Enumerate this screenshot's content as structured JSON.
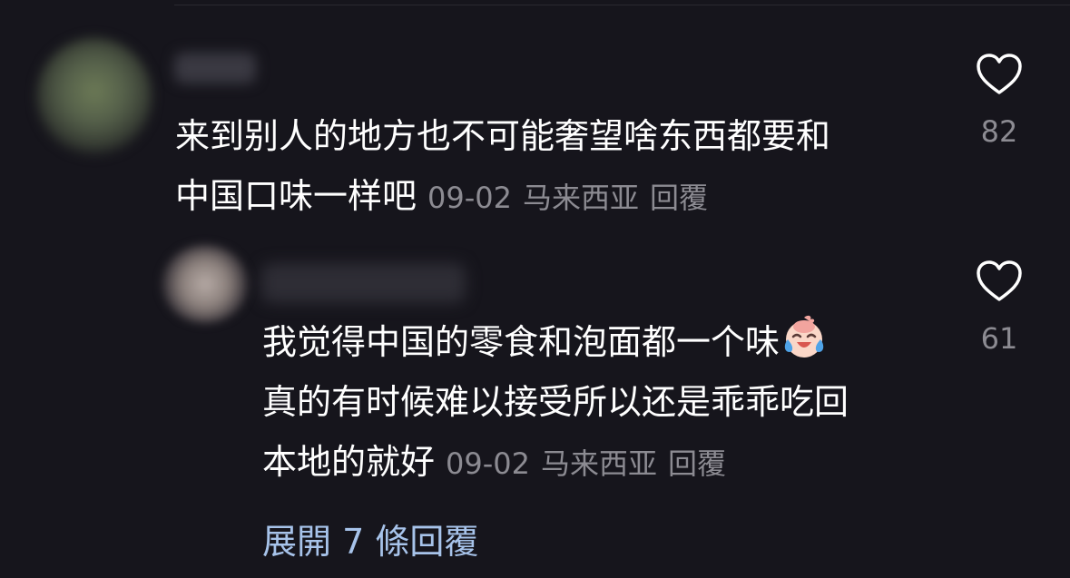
{
  "comments": [
    {
      "lines": [
        "来到别人的地方也不可能奢望啥东西都要和",
        "中国口味一样吧"
      ],
      "date": "09-02",
      "location": "马来西亚",
      "reply_label": "回覆",
      "likes": "82"
    },
    {
      "lines": [
        "我觉得中国的零食和泡面都一个味",
        "真的有时候难以接受所以还是乖乖吃回",
        "本地的就好"
      ],
      "emoji": "laughing-crying-emoji",
      "date": "09-02",
      "location": "马来西亚",
      "reply_label": "回覆",
      "likes": "61"
    }
  ],
  "expand_replies": "展開 7 條回覆",
  "colors": {
    "background": "#16151c",
    "text": "#ffffff",
    "meta": "#8c8b92",
    "link": "#a7c3ea"
  }
}
